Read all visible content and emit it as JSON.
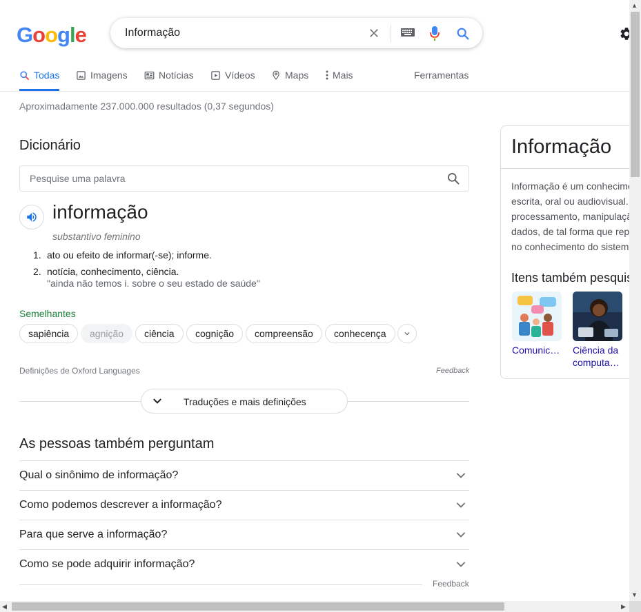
{
  "logo": {
    "letters": [
      "G",
      "o",
      "o",
      "g",
      "l",
      "e"
    ],
    "colors": [
      "#4285F4",
      "#EA4335",
      "#FBBC05",
      "#4285F4",
      "#34A853",
      "#EA4335"
    ]
  },
  "search": {
    "query": "Informação"
  },
  "tabs": [
    {
      "label": "Todas",
      "icon": "search-icon",
      "active": true
    },
    {
      "label": "Imagens",
      "icon": "image-icon"
    },
    {
      "label": "Notícias",
      "icon": "news-icon"
    },
    {
      "label": "Vídeos",
      "icon": "video-icon"
    },
    {
      "label": "Maps",
      "icon": "map-pin-icon"
    },
    {
      "label": "Mais",
      "icon": "more-vert-icon"
    }
  ],
  "tools_label": "Ferramentas",
  "result_stats": "Aproximadamente 237.000.000 resultados (0,37 segundos)",
  "dictionary": {
    "title": "Dicionário",
    "search_placeholder": "Pesquise uma palavra",
    "word": "informação",
    "part_of_speech": "substantivo feminino",
    "definitions": [
      {
        "num": "1.",
        "text": "ato ou efeito de informar(-se); informe."
      },
      {
        "num": "2.",
        "text": "notícia, conhecimento, ciência.",
        "example": "\"ainda não temos i. sobre o seu estado de saúde\""
      }
    ],
    "similar_label": "Semelhantes",
    "similar": [
      "sapiência",
      "agnição",
      "ciência",
      "cognição",
      "compreensão",
      "conhecença"
    ],
    "source": "Definições de Oxford Languages",
    "feedback": "Feedback",
    "more_button": "Traduções e mais definições"
  },
  "people_also_ask": {
    "title": "As pessoas também perguntam",
    "questions": [
      "Qual o sinônimo de informação?",
      "Como podemos descrever a informação?",
      "Para que serve a informação?",
      "Como se pode adquirir informação?"
    ],
    "feedback": "Feedback"
  },
  "knowledge_panel": {
    "title": "Informação",
    "description_lines": [
      "Informação é um conhecime",
      "escrita, oral ou audiovisual.",
      "processamento, manipulaçã",
      "dados, de tal forma que rep",
      "no conhecimento do sistem"
    ],
    "related_title": "Itens também pesquis",
    "related": [
      {
        "label": "Comunic…"
      },
      {
        "label": "Ciência da",
        "label2": "computa…"
      }
    ]
  },
  "colors": {
    "accent": "#1a73e8",
    "link": "#1a0dab",
    "green": "#188038"
  }
}
